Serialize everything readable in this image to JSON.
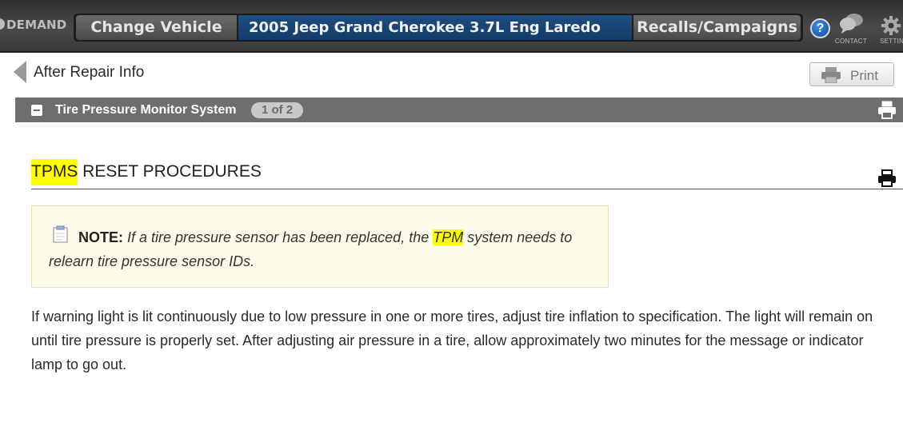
{
  "header": {
    "brand": "DEMAND",
    "change_vehicle_label": "Change Vehicle",
    "vehicle_name": "2005 Jeep Grand Cherokee 3.7L Eng Laredo",
    "recalls_label": "Recalls/Campaigns",
    "help_label": "?",
    "contact_label": "CONTACT",
    "settings_label": "SETTIN"
  },
  "nav": {
    "back_label": "After Repair Info",
    "print_label": "Print"
  },
  "section": {
    "title": "Tire Pressure Monitor System",
    "page_indicator": "1 of 2"
  },
  "content": {
    "title_highlight": "TPMS",
    "title_rest": " RESET PROCEDURES",
    "note_label": "NOTE:",
    "note_text_before": " If a tire pressure sensor has been replaced, the ",
    "note_highlight": "TPM",
    "note_text_after": " system needs to relearn tire pressure sensor IDs.",
    "body": "If warning light is lit continuously due to low pressure in one or more tires, adjust tire inflation to specification. The light will remain on until tire pressure is properly set. After adjusting air pressure in a tire, allow approximately two minutes for the message or indicator lamp to go out."
  },
  "colors": {
    "highlight": "#ffff00",
    "vehicle_bar": "#1e4d80",
    "section_bar": "#6e6e6e"
  }
}
